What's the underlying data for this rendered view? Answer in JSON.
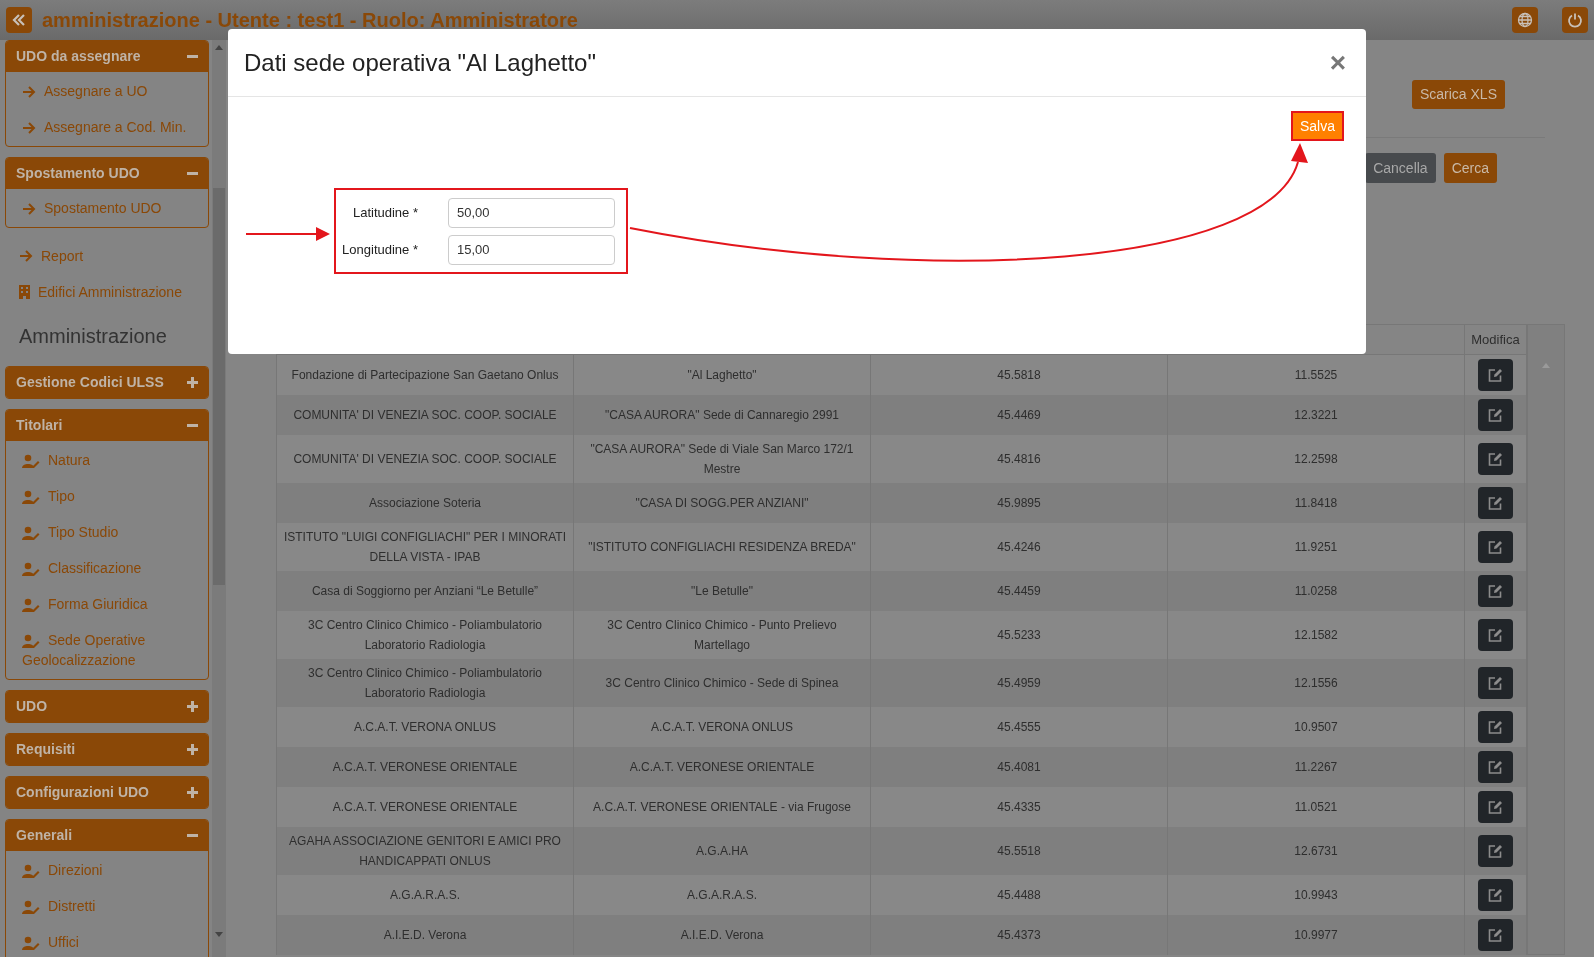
{
  "app_bar": {
    "title": "amministrazione - Utente : test1 - Ruolo: Amministratore"
  },
  "sidebar": [
    {
      "kind": "panel",
      "title": "UDO da assegnare",
      "expanded": true,
      "items": [
        {
          "kind": "arrow",
          "label": "Assegnare a UO"
        },
        {
          "kind": "arrow",
          "label": "Assegnare a Cod. Min."
        }
      ]
    },
    {
      "kind": "panel",
      "title": "Spostamento UDO",
      "expanded": true,
      "items": [
        {
          "kind": "arrow",
          "label": "Spostamento UDO"
        }
      ]
    },
    {
      "kind": "arrow",
      "label": "Report"
    },
    {
      "kind": "building",
      "label": "Edifici Amministrazione"
    },
    {
      "kind": "heading",
      "label": "Amministrazione"
    },
    {
      "kind": "panel",
      "title": "Gestione Codici ULSS",
      "expanded": false
    },
    {
      "kind": "panel",
      "title": "Titolari",
      "expanded": true,
      "items": [
        {
          "kind": "user",
          "label": "Natura"
        },
        {
          "kind": "user",
          "label": "Tipo"
        },
        {
          "kind": "user",
          "label": "Tipo Studio"
        },
        {
          "kind": "user",
          "label": "Classificazione"
        },
        {
          "kind": "user",
          "label": "Forma Giuridica"
        },
        {
          "kind": "user",
          "label": "Sede Operative Geolocalizzazione"
        }
      ]
    },
    {
      "kind": "panel",
      "title": "UDO",
      "expanded": false
    },
    {
      "kind": "panel",
      "title": "Requisiti",
      "expanded": false
    },
    {
      "kind": "panel",
      "title": "Configurazioni UDO",
      "expanded": false
    },
    {
      "kind": "panel",
      "title": "Generali",
      "expanded": true,
      "items": [
        {
          "kind": "user",
          "label": "Direzioni"
        },
        {
          "kind": "user",
          "label": "Distretti"
        },
        {
          "kind": "user",
          "label": "Uffici"
        }
      ]
    }
  ],
  "toolbar": {
    "export_button": "Scarica XLS",
    "buttons": [
      {
        "kind": "secondary",
        "label": "Cancella"
      },
      {
        "kind": "primary",
        "label": "Cerca"
      }
    ]
  },
  "table": {
    "edit_header": "Modifica",
    "rows": [
      {
        "cells": [
          "Fondazione di Partecipazione San Gaetano Onlus",
          "\"Al Laghetto\"",
          "45.5818",
          "11.5525"
        ]
      },
      {
        "cells": [
          "COMUNITA' DI VENEZIA SOC. COOP. SOCIALE",
          "\"CASA AURORA\" Sede di Cannaregio 2991",
          "45.4469",
          "12.3221"
        ]
      },
      {
        "cells": [
          "COMUNITA' DI VENEZIA SOC. COOP. SOCIALE",
          "\"CASA AURORA\" Sede di Viale San Marco 172/1 Mestre",
          "45.4816",
          "12.2598"
        ]
      },
      {
        "cells": [
          "Associazione Soteria",
          "\"CASA DI SOGG.PER ANZIANI\"",
          "45.9895",
          "11.8418"
        ]
      },
      {
        "cells": [
          "ISTITUTO \"LUIGI CONFIGLIACHI\" PER I MINORATI DELLA VISTA - IPAB",
          "\"ISTITUTO CONFIGLIACHI RESIDENZA BREDA\"",
          "45.4246",
          "11.9251"
        ]
      },
      {
        "cells": [
          "Casa di Soggiorno per Anziani “Le Betulle”",
          "\"Le Betulle\"",
          "45.4459",
          "11.0258"
        ]
      },
      {
        "cells": [
          "3C Centro Clinico Chimico - Poliambulatorio Laboratorio Radiologia",
          "3C Centro Clinico Chimico - Punto Prelievo Martellago",
          "45.5233",
          "12.1582"
        ]
      },
      {
        "cells": [
          "3C Centro Clinico Chimico - Poliambulatorio Laboratorio Radiologia",
          "3C Centro Clinico Chimico - Sede di Spinea",
          "45.4959",
          "12.1556"
        ]
      },
      {
        "cells": [
          "A.C.A.T. VERONA ONLUS",
          "A.C.A.T. VERONA ONLUS",
          "45.4555",
          "10.9507"
        ]
      },
      {
        "cells": [
          "A.C.A.T. VERONESE ORIENTALE",
          "A.C.A.T. VERONESE ORIENTALE",
          "45.4081",
          "11.2267"
        ]
      },
      {
        "cells": [
          "A.C.A.T. VERONESE ORIENTALE",
          "A.C.A.T. VERONESE ORIENTALE - via Frugose",
          "45.4335",
          "11.0521"
        ]
      },
      {
        "cells": [
          "AGAHA ASSOCIAZIONE GENITORI E AMICI PRO HANDICAPPATI ONLUS",
          "A.G.A.HA",
          "45.5518",
          "12.6731"
        ]
      },
      {
        "cells": [
          "A.G.A.R.A.S.",
          "A.G.A.R.A.S.",
          "45.4488",
          "10.9943"
        ]
      },
      {
        "cells": [
          "A.I.E.D. Verona",
          "A.I.E.D. Verona",
          "45.4373",
          "10.9977"
        ]
      }
    ]
  },
  "modal": {
    "title": "Dati sede operativa \"Al Laghetto\"",
    "close": "×",
    "save": "Salva",
    "fields": [
      {
        "label": "Latitudine *",
        "value": "50,00"
      },
      {
        "label": "Longitudine *",
        "value": "15,00"
      }
    ]
  }
}
